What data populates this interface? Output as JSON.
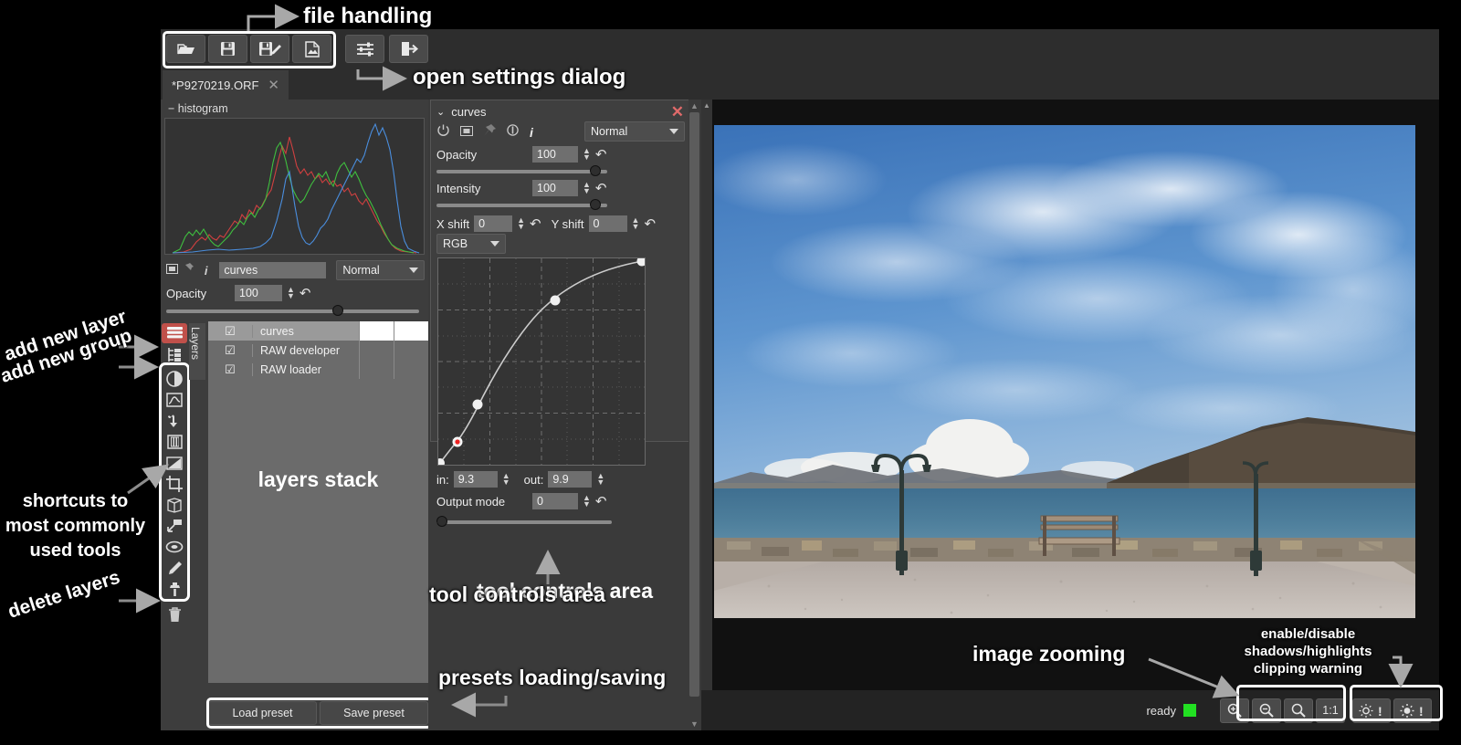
{
  "window": {
    "tab_label": "*P9270219.ORF",
    "tab_close": "✕"
  },
  "toolbar": {
    "file_buttons": [
      {
        "name": "open-file-button",
        "icon": "folder-open-icon"
      },
      {
        "name": "save-file-button",
        "icon": "floppy-save-icon"
      },
      {
        "name": "save-as-button",
        "icon": "floppy-pencil-icon"
      },
      {
        "name": "export-image-button",
        "icon": "document-image-icon"
      }
    ],
    "settings_button": {
      "name": "settings-button",
      "icon": "sliders-icon"
    },
    "exit_button": {
      "name": "exit-button",
      "icon": "exit-arrow-icon"
    }
  },
  "histogram": {
    "title": "− histogram",
    "collapse_glyph": "−",
    "channels": [
      "red",
      "green",
      "blue"
    ],
    "colors": {
      "red": "#d04040",
      "green": "#3fbf3f",
      "blue": "#4a8ede"
    }
  },
  "layer_properties": {
    "icons": [
      "mask-icon",
      "pin-icon",
      "info-icon"
    ],
    "name_value": "curves",
    "blend_mode": "Normal",
    "opacity_label": "Opacity",
    "opacity_value": "100",
    "undo_glyph": "↶"
  },
  "tool_rail": {
    "top_buttons": [
      {
        "name": "add-new-layer-button",
        "icon": "layers-stack-icon",
        "selected": true
      },
      {
        "name": "add-new-group-button",
        "icon": "group-tree-icon",
        "selected": false
      }
    ],
    "shortcut_buttons": [
      {
        "name": "brightness-contrast-tool",
        "icon": "contrast-circle-icon"
      },
      {
        "name": "curves-tool",
        "icon": "curve-graph-icon"
      },
      {
        "name": "color-pick-tool",
        "icon": "hand-pick-icon"
      },
      {
        "name": "film-tool",
        "icon": "film-strip-icon"
      },
      {
        "name": "gradient-tool",
        "icon": "gradient-icon"
      },
      {
        "name": "crop-tool",
        "icon": "crop-icon"
      },
      {
        "name": "perspective-tool",
        "icon": "cube-perspective-icon"
      },
      {
        "name": "scale-tool",
        "icon": "resize-arrow-icon"
      },
      {
        "name": "ellipse-select-tool",
        "icon": "ellipse-icon"
      },
      {
        "name": "pencil-tool",
        "icon": "pencil-icon"
      },
      {
        "name": "clone-stamp-tool",
        "icon": "clone-stamp-icon"
      }
    ],
    "delete_button": {
      "name": "delete-layers-button",
      "icon": "trash-icon"
    }
  },
  "layers_panel": {
    "vertical_tab_label": "Layers",
    "rows": [
      {
        "name": "curves",
        "checked": true,
        "selected": true
      },
      {
        "name": "RAW developer",
        "checked": true,
        "selected": false
      },
      {
        "name": "RAW loader",
        "checked": true,
        "selected": false
      }
    ],
    "check_glyph": "☑",
    "load_preset_label": "Load preset",
    "save_preset_label": "Save preset"
  },
  "tool_panel": {
    "collapse_glyph": "⌄",
    "title": "curves",
    "close_glyph": "✕",
    "icons": [
      "power-icon",
      "mask-icon",
      "pin-icon",
      "half-circle-icon",
      "info-icon"
    ],
    "blend_mode": "Normal",
    "opacity_label": "Opacity",
    "opacity_value": "100",
    "intensity_label": "Intensity",
    "intensity_value": "100",
    "x_shift_label": "X shift",
    "x_shift_value": "0",
    "y_shift_label": "Y shift",
    "y_shift_value": "0",
    "channel_select": "RGB",
    "in_label": "in:",
    "in_value": "9.3",
    "out_label": "out:",
    "out_value": "9.9",
    "output_mode_label": "Output mode",
    "output_mode_value": "0",
    "undo_glyph": "↶"
  },
  "chart_data": {
    "type": "line",
    "title": "curves",
    "xlabel": "in",
    "ylabel": "out",
    "xlim": [
      0,
      100
    ],
    "ylim": [
      0,
      100
    ],
    "grid": true,
    "control_points": [
      {
        "x": 0.0,
        "y": 0.0,
        "color": "#ffffff"
      },
      {
        "x": 9.3,
        "y": 9.9,
        "color": "#ee2222"
      },
      {
        "x": 19.0,
        "y": 27.5,
        "color": "#ffffff"
      },
      {
        "x": 56.5,
        "y": 78.0,
        "color": "#ffffff"
      },
      {
        "x": 100.0,
        "y": 100.0,
        "color": "#ffffff"
      }
    ],
    "curve_color": "#cccccc"
  },
  "status": {
    "ready_label": "ready",
    "led_color": "#22e022",
    "zoom_buttons": [
      {
        "name": "zoom-in-button",
        "label": "+"
      },
      {
        "name": "zoom-out-button",
        "label": "−"
      },
      {
        "name": "zoom-fit-button",
        "label": ""
      },
      {
        "name": "zoom-1-1-button",
        "label": "1:1"
      }
    ],
    "clipping_buttons": [
      {
        "name": "shadow-clipping-button",
        "label": "!"
      },
      {
        "name": "highlight-clipping-button",
        "label": "!"
      }
    ]
  },
  "annotations": {
    "file_handling": "file handling",
    "open_settings_dialog": "open settings dialog",
    "add_new_layer": "add new layer",
    "add_new_group": "add new group",
    "shortcuts": "shortcuts to\nmost commonly\nused tools",
    "delete_layers": "delete layers",
    "layers_stack": "layers stack",
    "tool_controls_area": "tool controls area",
    "presets_loading_saving": "presets loading/saving",
    "image_zooming": "image zooming",
    "clipping_warning": "enable/disable\nshadows/highlights\nclipping warning"
  }
}
